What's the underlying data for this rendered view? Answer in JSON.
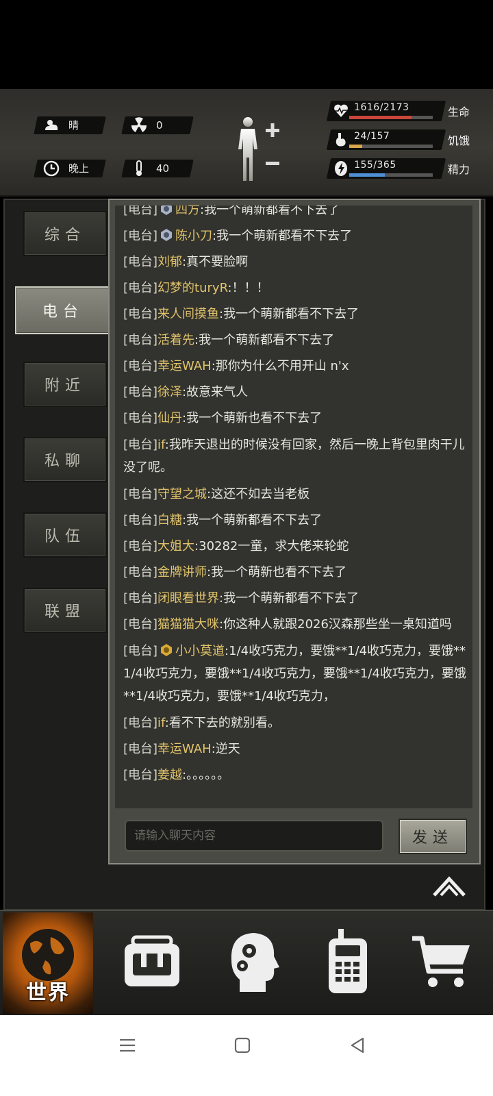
{
  "status": {
    "weather": {
      "icon": "cloud-sun-icon",
      "label": "晴"
    },
    "radiation": {
      "icon": "radiation-icon",
      "value": "0"
    },
    "time_of_day": {
      "icon": "clock-icon",
      "label": "晚上"
    },
    "temperature": {
      "icon": "thermometer-icon",
      "value": "40"
    },
    "bars": [
      {
        "icon": "heart-pulse-icon",
        "value": "1616/2173",
        "label": "生命",
        "fraction": 0.744,
        "color": "#c8463a"
      },
      {
        "icon": "stomach-icon",
        "value": "24/157",
        "label": "饥饿",
        "fraction": 0.153,
        "color": "#d9a64a"
      },
      {
        "icon": "energy-icon",
        "value": "155/365",
        "label": "精力",
        "fraction": 0.425,
        "color": "#4f8fd6"
      }
    ]
  },
  "tabs": [
    {
      "label": "综合",
      "active": false
    },
    {
      "label": "电台",
      "active": true
    },
    {
      "label": "附近",
      "active": false
    },
    {
      "label": "私聊",
      "active": false
    },
    {
      "label": "队伍",
      "active": false
    },
    {
      "label": "联盟",
      "active": false
    }
  ],
  "messages": [
    {
      "tag": "[电台]",
      "badge": true,
      "name": "四方",
      "text": ":我一个萌新都看不下去了"
    },
    {
      "tag": "[电台]",
      "badge": true,
      "name": "陈小刀",
      "text": ":我一个萌新都看不下去了"
    },
    {
      "tag": "[电台]",
      "badge": false,
      "name": "刘郁",
      "text": ":真不要脸啊"
    },
    {
      "tag": "[电台]",
      "badge": false,
      "name": "幻梦的turyR",
      "text": ":！！！"
    },
    {
      "tag": "[电台]",
      "badge": false,
      "name": "来人间摸鱼",
      "text": ":我一个萌新都看不下去了"
    },
    {
      "tag": "[电台]",
      "badge": false,
      "name": "活着先",
      "text": ":我一个萌新都看不下去了"
    },
    {
      "tag": "[电台]",
      "badge": false,
      "name": "幸运WAH",
      "text": ":那你为什么不用开山 n'x"
    },
    {
      "tag": "[电台]",
      "badge": false,
      "name": "徐泽",
      "text": ":故意来气人"
    },
    {
      "tag": "[电台]",
      "badge": false,
      "name": "仙丹",
      "text": ":我一个萌新也看不下去了"
    },
    {
      "tag": "[电台]",
      "badge": false,
      "name": "if",
      "text": ":我昨天退出的时候没有回家，然后一晚上背包里肉干儿没了呢。",
      "wrap": true
    },
    {
      "tag": "[电台]",
      "badge": false,
      "name": "守望之城",
      "text": ":这还不如去当老板"
    },
    {
      "tag": "[电台]",
      "badge": false,
      "name": "白糖",
      "text": ":我一个萌新都看不下去了"
    },
    {
      "tag": "[电台]",
      "badge": false,
      "name": "大姐大",
      "text": ":30282一童，求大佬来轮蛇"
    },
    {
      "tag": "[电台]",
      "badge": false,
      "name": "金牌讲师",
      "text": ":我一个萌新也看不下去了"
    },
    {
      "tag": "[电台]",
      "badge": false,
      "name": "闭眼看世界",
      "text": ":我一个萌新都看不下去了"
    },
    {
      "tag": "[电台]",
      "badge": false,
      "name": "猫猫猫大咪",
      "text": ":你这种人就跟2026汉森那些坐一桌知道吗"
    },
    {
      "tag": "[电台]",
      "badge": true,
      "name": "小小莫道",
      "text": ":1/4收巧克力，要饿**1/4收巧克力，要饿**1/4收巧克力，要饿**1/4收巧克力，要饿**1/4收巧克力，要饿**1/4收巧克力，要饿**1/4收巧克力，",
      "wrap": true,
      "gold": true
    },
    {
      "tag": "[电台]",
      "badge": false,
      "name": "if",
      "text": ":看不下去的就别看。"
    },
    {
      "tag": "[电台]",
      "badge": false,
      "name": "幸运WAH",
      "text": ":逆天"
    },
    {
      "tag": "[电台]",
      "badge": false,
      "name": "姜越",
      "text": ":。。。。。。"
    }
  ],
  "input": {
    "placeholder": "请输入聊天内容"
  },
  "send_label": "发送",
  "nav": {
    "world_label": "世界",
    "items": [
      {
        "icon": "backpack-icon"
      },
      {
        "icon": "skills-head-icon"
      },
      {
        "icon": "radio-icon"
      },
      {
        "icon": "shopping-cart-icon"
      }
    ]
  },
  "colors": {
    "name": "#e0c36a",
    "accent": "#e5891d"
  }
}
